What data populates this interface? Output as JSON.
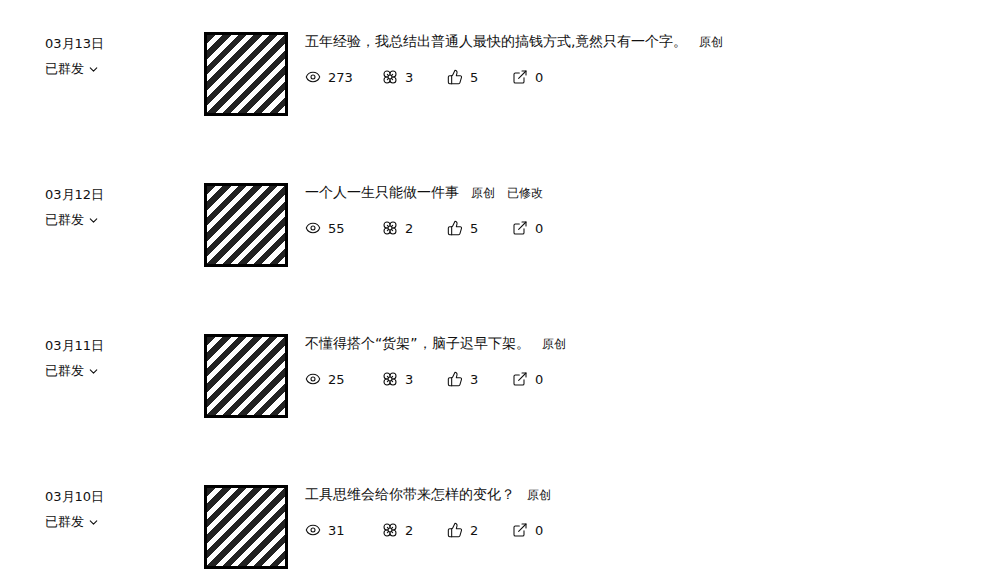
{
  "articles": [
    {
      "date": "03月13日",
      "status": "已群发",
      "title": "五年经验，我总结出普通人最快的搞钱方式,竟然只有一个字。",
      "tags": [
        "原创"
      ],
      "stats": [
        {
          "kind": "views",
          "value": "273"
        },
        {
          "kind": "wow",
          "value": "3"
        },
        {
          "kind": "likes",
          "value": "5"
        },
        {
          "kind": "shares",
          "value": "0"
        }
      ]
    },
    {
      "date": "03月12日",
      "status": "已群发",
      "title": "一个人一生只能做一件事",
      "tags": [
        "原创",
        "已修改"
      ],
      "stats": [
        {
          "kind": "views",
          "value": "55"
        },
        {
          "kind": "wow",
          "value": "2"
        },
        {
          "kind": "likes",
          "value": "5"
        },
        {
          "kind": "shares",
          "value": "0"
        }
      ]
    },
    {
      "date": "03月11日",
      "status": "已群发",
      "title": "不懂得搭个“货架”，脑子迟早下架。",
      "tags": [
        "原创"
      ],
      "stats": [
        {
          "kind": "views",
          "value": "25"
        },
        {
          "kind": "wow",
          "value": "3"
        },
        {
          "kind": "likes",
          "value": "3"
        },
        {
          "kind": "shares",
          "value": "0"
        }
      ]
    },
    {
      "date": "03月10日",
      "status": "已群发",
      "title": "工具思维会给你带来怎样的变化？",
      "tags": [
        "原创"
      ],
      "stats": [
        {
          "kind": "views",
          "value": "31"
        },
        {
          "kind": "wow",
          "value": "2"
        },
        {
          "kind": "likes",
          "value": "2"
        },
        {
          "kind": "shares",
          "value": "0"
        }
      ]
    }
  ]
}
